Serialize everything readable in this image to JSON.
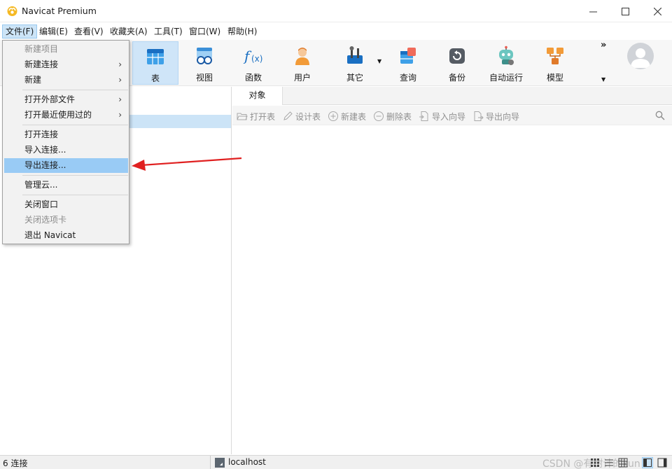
{
  "window": {
    "title": "Navicat Premium"
  },
  "menubar": {
    "items": [
      {
        "label": "文件(F)"
      },
      {
        "label": "编辑(E)"
      },
      {
        "label": "查看(V)"
      },
      {
        "label": "收藏夹(A)"
      },
      {
        "label": "工具(T)"
      },
      {
        "label": "窗口(W)"
      },
      {
        "label": "帮助(H)"
      }
    ]
  },
  "toolbar": {
    "items": [
      {
        "label": "表",
        "icon": "table-icon"
      },
      {
        "label": "视图",
        "icon": "view-icon"
      },
      {
        "label": "函数",
        "icon": "function-icon"
      },
      {
        "label": "用户",
        "icon": "user-icon"
      },
      {
        "label": "其它",
        "icon": "tools-icon"
      },
      {
        "label": "查询",
        "icon": "query-icon"
      },
      {
        "label": "备份",
        "icon": "backup-icon"
      },
      {
        "label": "自动运行",
        "icon": "robot-icon"
      },
      {
        "label": "模型",
        "icon": "model-icon"
      }
    ],
    "more": "»"
  },
  "file_menu": {
    "items": [
      {
        "label": "新建项目",
        "disabled": true
      },
      {
        "label": "新建连接",
        "submenu": true
      },
      {
        "label": "新建",
        "submenu": true
      },
      {
        "label": "打开外部文件",
        "submenu": true
      },
      {
        "label": "打开最近使用过的",
        "submenu": true
      },
      {
        "label": "打开连接"
      },
      {
        "label": "导入连接..."
      },
      {
        "label": "导出连接...",
        "highlighted": true
      },
      {
        "label": "管理云..."
      },
      {
        "label": "关闭窗口"
      },
      {
        "label": "关闭选项卡",
        "disabled": true
      },
      {
        "label": "退出 Navicat"
      }
    ],
    "submenu_arrow": "›"
  },
  "tabs": {
    "objects": "对象"
  },
  "object_toolbar": {
    "open_table": "打开表",
    "design_table": "设计表",
    "new_table": "新建表",
    "delete_table": "删除表",
    "import_wizard": "导入向导",
    "export_wizard": "导出向导"
  },
  "statusbar": {
    "connections": "6 连接",
    "host": "localhost",
    "watermark": "CSDN @有树计的kun"
  },
  "colors": {
    "highlight": "#99cbf5",
    "selection": "#cce4f7",
    "annotation_arrow": "#e02020"
  }
}
